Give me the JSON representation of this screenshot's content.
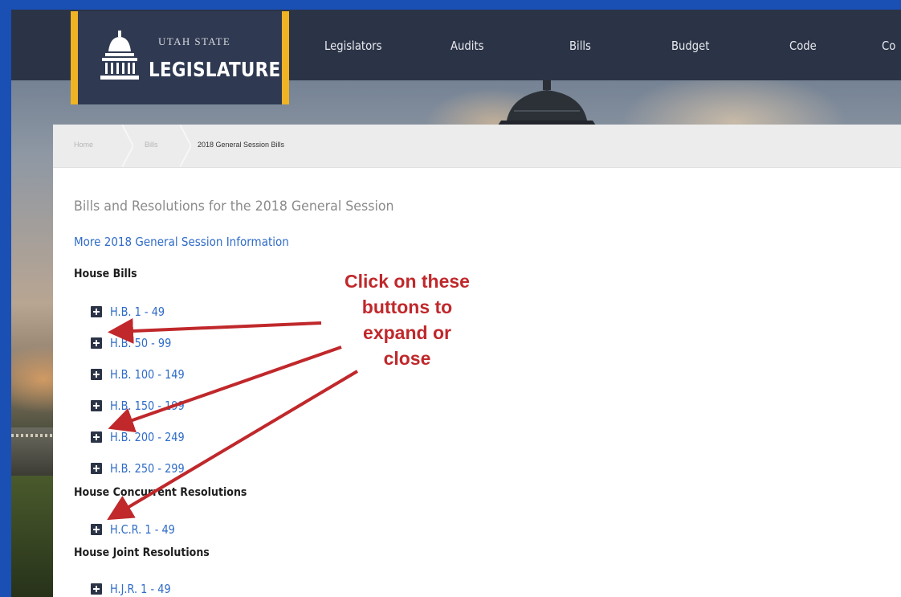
{
  "logo": {
    "top_line": "UTAH STATE",
    "main_line": "LEGISLATURE"
  },
  "nav": {
    "items": [
      "Legislators",
      "Audits",
      "Bills",
      "Budget",
      "Code",
      "Co"
    ]
  },
  "breadcrumb": {
    "home": "Home",
    "bills": "Bills",
    "current": "2018 General Session Bills"
  },
  "main": {
    "title": "Bills and Resolutions for the 2018 General Session",
    "info_link": "More 2018 General Session Information",
    "sections": [
      {
        "heading": "House Bills",
        "bills": [
          "H.B. 1 - 49",
          "H.B. 50 - 99",
          "H.B. 100 - 149",
          "H.B. 150 - 199",
          "H.B. 200 - 249",
          "H.B. 250 - 299"
        ]
      },
      {
        "heading": "House Concurrent Resolutions",
        "bills": [
          "H.C.R. 1 - 49"
        ]
      },
      {
        "heading": "House Joint Resolutions",
        "bills": [
          "H.J.R. 1 - 49"
        ]
      }
    ]
  },
  "annotation": {
    "lines": [
      "Click on these",
      "buttons to",
      "expand or",
      "close"
    ]
  },
  "colors": {
    "frame_blue": "#1a4fb4",
    "nav_bg": "#2b3346",
    "logo_gold": "#f0b323",
    "link_blue": "#2f6cc8",
    "annotation_red": "#c0282b"
  }
}
